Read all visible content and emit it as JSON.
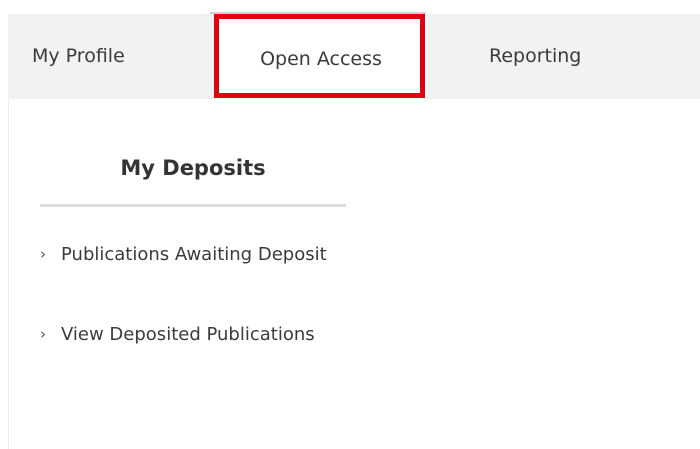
{
  "nav": {
    "tabs": [
      {
        "label": "My Profile",
        "active": false
      },
      {
        "label": "Open Access",
        "active": true,
        "highlighted": true
      },
      {
        "label": "Reporting",
        "active": false
      }
    ]
  },
  "sidebar": {
    "title": "My Deposits",
    "items": [
      {
        "icon": "chevron-right-icon",
        "glyph": "›",
        "label": "Publications Awaiting Deposit"
      },
      {
        "icon": "chevron-right-icon",
        "glyph": "›",
        "label": "View Deposited Publications"
      }
    ]
  },
  "colors": {
    "nav_background": "#f2f2f2",
    "highlight_border": "#e0000f",
    "text": "#333333",
    "divider": "#dddddd"
  }
}
